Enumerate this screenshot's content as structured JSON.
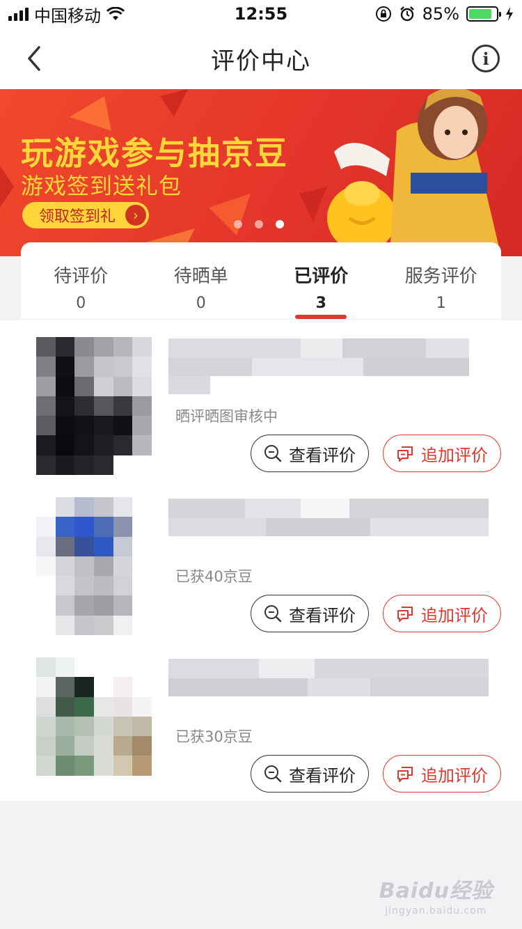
{
  "status_bar": {
    "carrier": "中国移动",
    "time": "12:55",
    "battery": "85%"
  },
  "nav": {
    "title": "评价中心"
  },
  "banner": {
    "title": "玩游戏参与抽京豆",
    "subtitle": "游戏签到送礼包",
    "button_label": "领取签到礼",
    "colors": {
      "background": "#e3352a",
      "accent_text": "#ffd73a"
    }
  },
  "tabs": [
    {
      "label": "待评价",
      "count": "0"
    },
    {
      "label": "待晒单",
      "count": "0"
    },
    {
      "label": "已评价",
      "count": "3"
    },
    {
      "label": "服务评价",
      "count": "1"
    }
  ],
  "orders": [
    {
      "note": "晒评晒图审核中",
      "view_label": "查看评价",
      "add_label": "追加评价"
    },
    {
      "note": "已获40京豆",
      "view_label": "查看评价",
      "add_label": "追加评价"
    },
    {
      "note": "已获30京豆",
      "view_label": "查看评价",
      "add_label": "追加评价"
    }
  ],
  "watermark": {
    "main": "Baidu经验",
    "sub": "jingyan.baidu.com"
  },
  "colors": {
    "brand_red": "#e0362c",
    "page_bg": "#f2f2f4"
  }
}
